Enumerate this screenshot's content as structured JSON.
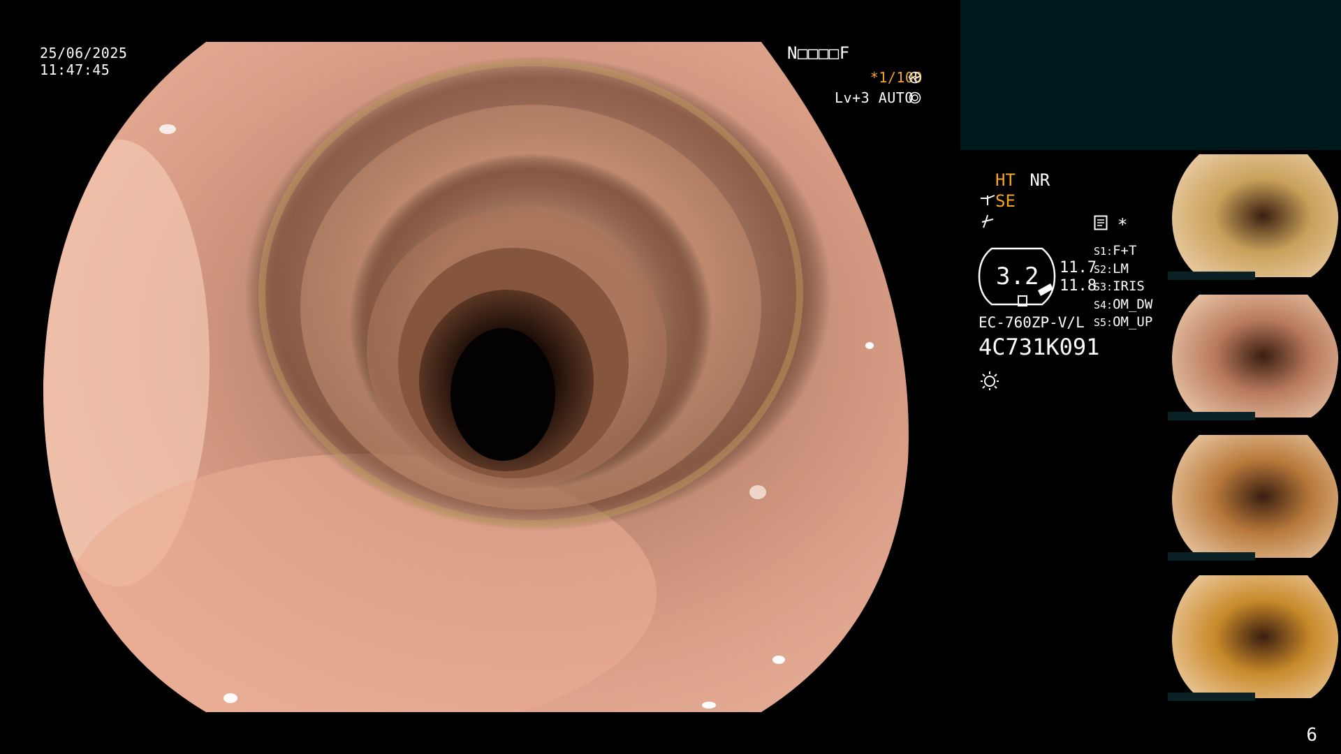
{
  "overlay": {
    "date": "25/06/2025",
    "time": "11:47:45",
    "patient_code": "N□□□□F",
    "shutter": "*1/100",
    "level": "Lv+3 AUTO"
  },
  "settings": {
    "ht": "HT",
    "nr": "NR",
    "se": "SE",
    "gauge_value": "3.2",
    "val_top": "11.7",
    "val_bottom": "11.8",
    "model": "EC-760ZP-V/L",
    "serial": "4C731K091",
    "asterisk": "*"
  },
  "presets": [
    {
      "slot": "S1:",
      "value": "F+T"
    },
    {
      "slot": "S2:",
      "value": "LM"
    },
    {
      "slot": "S3:",
      "value": "IRIS"
    },
    {
      "slot": "S4:",
      "value": "OM_DW"
    },
    {
      "slot": "S5:",
      "value": "OM_UP"
    }
  ],
  "thumbnails": [
    {
      "name": "thumbnail-1",
      "tone": "#c9a15a"
    },
    {
      "name": "thumbnail-2",
      "tone": "#b97a5e"
    },
    {
      "name": "thumbnail-3",
      "tone": "#b8793a"
    },
    {
      "name": "thumbnail-4",
      "tone": "#c98a2a"
    }
  ],
  "icons": {
    "shutter_icon": "aperture-icon",
    "auto_icon": "auto-iris-icon",
    "se_icon": "structure-enhance-icon",
    "freeze_icon": "freeze-icon",
    "memo_icon": "memo-icon",
    "light_icon": "light-icon"
  },
  "page_number": "6"
}
